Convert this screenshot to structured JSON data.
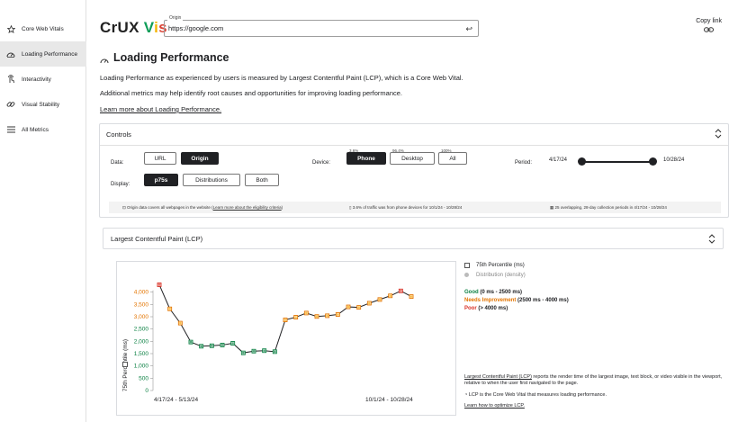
{
  "sidebar": {
    "items": [
      {
        "label": "Core Web Vitals",
        "icon": "star-icon"
      },
      {
        "label": "Loading Performance",
        "icon": "speedometer-icon",
        "active": true
      },
      {
        "label": "Interactivity",
        "icon": "touch-icon"
      },
      {
        "label": "Visual Stability",
        "icon": "link-chain-icon"
      },
      {
        "label": "All Metrics",
        "icon": "menu-icon"
      }
    ]
  },
  "header": {
    "logo_crux": "CrUX ",
    "logo_v": "V",
    "logo_i": "i",
    "logo_s": "s",
    "origin_label": "Origin",
    "origin_value": "https://google.com",
    "copy_link": "Copy link"
  },
  "page": {
    "title": "Loading Performance",
    "desc1": "Loading Performance as experienced by users is measured by Largest Contentful Paint (LCP), which is a Core Web Vital.",
    "desc2": "Additional metrics may help identify root causes and opportunities for improving loading performance.",
    "learn_more": "Learn more about Loading Performance."
  },
  "controls": {
    "title": "Controls",
    "data_label": "Data:",
    "data_options": [
      "URL",
      "Origin"
    ],
    "data_selected": "Origin",
    "display_label": "Display:",
    "display_options": [
      "p75s",
      "Distributions",
      "Both"
    ],
    "display_selected": "p75s",
    "device_label": "Device:",
    "device_options": [
      "Phone",
      "Desktop",
      "All"
    ],
    "device_pcts": [
      "3.6%",
      "96.4%",
      "100%"
    ],
    "device_selected": "Phone",
    "period_label": "Period:",
    "period_start": "4/17/24",
    "period_end": "10/28/24",
    "info_origin": "Origin data covers all webpages in the website (",
    "info_origin_link": "Learn more about the eligibility criteria",
    "info_origin_end": ")",
    "info_traffic": "3.6% of traffic was from phone devices for 10/1/24 - 10/28/24",
    "info_periods": "25 overlapping, 28-day collection periods in 4/17/24 - 10/28/24"
  },
  "lcp": {
    "title": "Largest Contentful Paint (LCP)",
    "legend_p75": "75th Percentile (ms)",
    "legend_dist": "Distribution (density)",
    "good_label": "Good",
    "good_range": " (0 ms - 2500 ms)",
    "ni_label": "Needs Improvement",
    "ni_range": " (2500 ms - 4000 ms)",
    "poor_label": "Poor",
    "poor_range": " (> 4000 ms)",
    "desc_link": "Largest Contentful Paint (LCP)",
    "desc_rest": " reports the render time of the largest image, text block, or video visible in the viewport, relative to when the user first navigated to the page.",
    "cwv_note": "LCP is the Core Web Vital that measures loading performance.",
    "optimize_link": "Learn how to optimize LCP."
  },
  "colors": {
    "good": "#0b8043",
    "needs_improvement": "#e37400",
    "poor": "#d93025",
    "line": "#202124"
  },
  "chart_data": {
    "type": "line",
    "ylabel": "75th Percentile (ms)",
    "ylim": [
      0,
      4500
    ],
    "yticks": [
      "4,000",
      "3,500",
      "3,000",
      "2,500",
      "2,000",
      "1,500",
      "1,000",
      "500",
      "0"
    ],
    "ytick_values": [
      4000,
      3500,
      3000,
      2500,
      2000,
      1500,
      1000,
      500,
      0
    ],
    "x_start_label": "4/17/24 - 5/13/24",
    "x_end_label": "10/1/24 - 10/28/24",
    "values": [
      4300,
      3320,
      2740,
      1970,
      1800,
      1820,
      1850,
      1920,
      1530,
      1600,
      1620,
      1580,
      2870,
      2980,
      3150,
      3010,
      3040,
      3090,
      3400,
      3380,
      3550,
      3700,
      3850,
      4050,
      3820
    ]
  }
}
